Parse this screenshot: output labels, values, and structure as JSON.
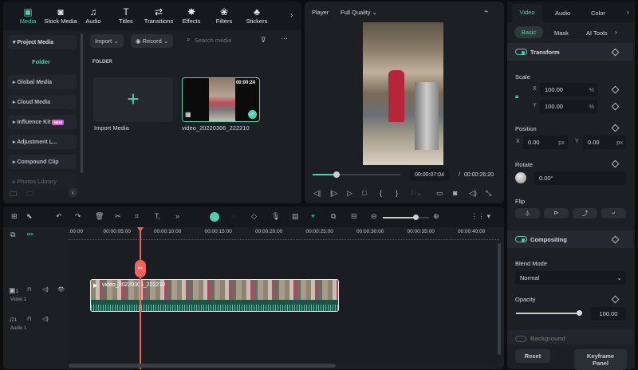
{
  "media_tabs": [
    {
      "label": "Media",
      "icon": "media-icon",
      "glyph": "▣",
      "active": true
    },
    {
      "label": "Stock Media",
      "icon": "stock-media-icon",
      "glyph": "◙"
    },
    {
      "label": "Audio",
      "icon": "music-note-icon",
      "glyph": "♫"
    },
    {
      "label": "Titles",
      "icon": "titles-icon",
      "glyph": "T"
    },
    {
      "label": "Transitions",
      "icon": "transitions-icon",
      "glyph": "⇄"
    },
    {
      "label": "Effects",
      "icon": "effects-icon",
      "glyph": "✸"
    },
    {
      "label": "Filters",
      "icon": "filters-icon",
      "glyph": "❀"
    },
    {
      "label": "Stickers",
      "icon": "stickers-icon",
      "glyph": "♣"
    }
  ],
  "sidebar": {
    "project_media": "Project Media",
    "folder": "Folder",
    "items": [
      "Global Media",
      "Cloud Media",
      "Influence Kit",
      "Adjustment L...",
      "Compound Clip",
      "Photos Library"
    ],
    "new_badge": "NEW"
  },
  "media_toolbar": {
    "import": "Import",
    "record": "Record",
    "search_placeholder": "Search media"
  },
  "media_content": {
    "section": "FOLDER",
    "import_label": "Import Media",
    "clip_name": "video_20220306_222210",
    "clip_duration": "00:00:24"
  },
  "player": {
    "label": "Player",
    "quality": "Full Quality",
    "current_time": "00:00:07:04",
    "separator": "/",
    "total_time": "00:00:26:20",
    "progress": 0.27
  },
  "right_panel": {
    "tabs": [
      "Video",
      "Audio",
      "Color"
    ],
    "subtabs": [
      "Basic",
      "Mask",
      "AI Tools"
    ],
    "transform": "Transform",
    "scale": "Scale",
    "scale_x": "100.00",
    "scale_y": "100.00",
    "percent": "%",
    "x": "X",
    "y": "Y",
    "position": "Position",
    "pos_x": "0.00",
    "pos_y": "0.00",
    "px": "px",
    "rotate": "Rotate",
    "rotate_value": "0.00°",
    "flip": "Flip",
    "compositing": "Compositing",
    "blend_mode": "Blend Mode",
    "blend_value": "Normal",
    "opacity": "Opacity",
    "opacity_value": "100.00",
    "opacity_level": 1.0,
    "background": "Background",
    "reset": "Reset",
    "keyframe": "Keyframe Panel"
  },
  "timeline": {
    "ticks": [
      ":00:00",
      "00:00:05:00",
      "00:00:10:00",
      "00:00:15:00",
      "00:00:20:00",
      "00:00:25:00",
      "00:00:30:00",
      "00:00:35:00",
      "00:00:40:00"
    ],
    "video_track": "Video 1",
    "audio_track": "Audio 1",
    "track_num": "1",
    "clip_label": "video_20220306_222210",
    "zoom_level": 0.7
  },
  "colors": {
    "accent": "#4fd1b0",
    "playhead": "#f0625f"
  }
}
